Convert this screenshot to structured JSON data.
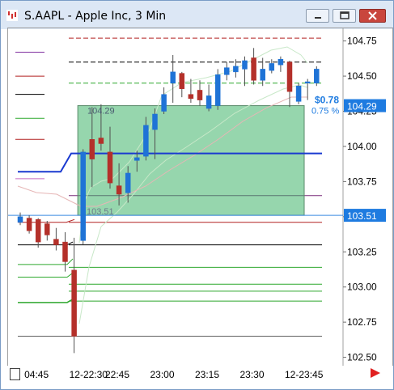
{
  "window": {
    "title": "S.AAPL - Apple Inc, 3 Min",
    "icon": "aapl-chart-icon",
    "buttons": [
      "minimize-icon",
      "maximize-icon",
      "close-icon"
    ]
  },
  "chart_data": {
    "type": "candlestick",
    "symbol": "S.AAPL",
    "interval": "3 Min",
    "ylim": [
      102.44,
      104.84
    ],
    "y_ticks": [
      "104.75",
      "104.50",
      "104.25",
      "104.00",
      "103.75",
      "103.50",
      "103.25",
      "103.00",
      "102.75",
      "102.50"
    ],
    "x_ticks": [
      "04:45",
      "12-22:30",
      "22:45",
      "23:00",
      "23:15",
      "23:30",
      "12-23:45"
    ],
    "x_tick_index": [
      1,
      6,
      10,
      15,
      20,
      25,
      30
    ],
    "candles": [
      {
        "i": 0,
        "o": 103.46,
        "h": 103.53,
        "l": 103.44,
        "c": 103.5
      },
      {
        "i": 1,
        "o": 103.49,
        "h": 103.51,
        "l": 103.38,
        "c": 103.4
      },
      {
        "i": 2,
        "o": 103.48,
        "h": 103.49,
        "l": 103.28,
        "c": 103.32
      },
      {
        "i": 3,
        "o": 103.45,
        "h": 103.47,
        "l": 103.33,
        "c": 103.37
      },
      {
        "i": 4,
        "o": 103.34,
        "h": 103.42,
        "l": 103.26,
        "c": 103.3
      },
      {
        "i": 5,
        "o": 103.32,
        "h": 103.39,
        "l": 103.11,
        "c": 103.18
      },
      {
        "i": 6,
        "o": 103.12,
        "h": 103.35,
        "l": 102.53,
        "c": 102.65
      },
      {
        "i": 7,
        "o": 103.33,
        "h": 103.98,
        "l": 103.3,
        "c": 103.96
      },
      {
        "i": 8,
        "o": 104.05,
        "h": 104.28,
        "l": 103.71,
        "c": 103.91
      },
      {
        "i": 9,
        "o": 104.06,
        "h": 104.3,
        "l": 103.97,
        "c": 104.02
      },
      {
        "i": 10,
        "o": 103.96,
        "h": 104.14,
        "l": 103.7,
        "c": 103.74
      },
      {
        "i": 11,
        "o": 103.72,
        "h": 103.88,
        "l": 103.58,
        "c": 103.66
      },
      {
        "i": 12,
        "o": 103.67,
        "h": 103.86,
        "l": 103.6,
        "c": 103.81
      },
      {
        "i": 13,
        "o": 103.9,
        "h": 103.97,
        "l": 103.82,
        "c": 103.92
      },
      {
        "i": 14,
        "o": 103.93,
        "h": 104.21,
        "l": 103.9,
        "c": 104.15
      },
      {
        "i": 15,
        "o": 104.12,
        "h": 104.27,
        "l": 103.91,
        "c": 104.23
      },
      {
        "i": 16,
        "o": 104.25,
        "h": 104.42,
        "l": 104.23,
        "c": 104.37
      },
      {
        "i": 17,
        "o": 104.45,
        "h": 104.65,
        "l": 104.31,
        "c": 104.53
      },
      {
        "i": 18,
        "o": 104.52,
        "h": 104.53,
        "l": 104.35,
        "c": 104.41
      },
      {
        "i": 19,
        "o": 104.37,
        "h": 104.48,
        "l": 104.31,
        "c": 104.34
      },
      {
        "i": 20,
        "o": 104.4,
        "h": 104.47,
        "l": 104.29,
        "c": 104.33
      },
      {
        "i": 21,
        "o": 104.27,
        "h": 104.44,
        "l": 104.25,
        "c": 104.36
      },
      {
        "i": 22,
        "o": 104.29,
        "h": 104.55,
        "l": 104.26,
        "c": 104.51
      },
      {
        "i": 23,
        "o": 104.51,
        "h": 104.6,
        "l": 104.47,
        "c": 104.56
      },
      {
        "i": 24,
        "o": 104.53,
        "h": 104.62,
        "l": 104.49,
        "c": 104.57
      },
      {
        "i": 25,
        "o": 104.55,
        "h": 104.64,
        "l": 104.43,
        "c": 104.61
      },
      {
        "i": 26,
        "o": 104.63,
        "h": 104.7,
        "l": 104.44,
        "c": 104.47
      },
      {
        "i": 27,
        "o": 104.47,
        "h": 104.63,
        "l": 104.43,
        "c": 104.55
      },
      {
        "i": 28,
        "o": 104.54,
        "h": 104.62,
        "l": 104.52,
        "c": 104.59
      },
      {
        "i": 29,
        "o": 104.58,
        "h": 104.64,
        "l": 104.53,
        "c": 104.62
      },
      {
        "i": 30,
        "o": 104.6,
        "h": 104.61,
        "l": 104.28,
        "c": 104.39
      },
      {
        "i": 31,
        "o": 104.32,
        "h": 104.45,
        "l": 104.3,
        "c": 104.43
      },
      {
        "i": 32,
        "o": 104.45,
        "h": 104.48,
        "l": 104.33,
        "c": 104.46
      },
      {
        "i": 33,
        "o": 104.45,
        "h": 104.57,
        "l": 104.43,
        "c": 104.55
      }
    ],
    "price_label": {
      "text": "104.29",
      "value": 104.29,
      "color": "#1e7be0"
    },
    "price_label_2": {
      "text": "103.51",
      "value": 103.51,
      "color": "#1e7be0"
    },
    "change_text": "$0.78",
    "change_pct_text": "0.75 %",
    "rect_high_text": "104.29",
    "rect_low_text": "103.51",
    "measure_rect": {
      "x0_index": 6.5,
      "x1_index": 34.5,
      "y_high": 104.29,
      "y_low": 103.51,
      "fill": "#3fb56a"
    },
    "colors": {
      "up": "#1f73d6",
      "down": "#b4302a",
      "wick": "#606060"
    }
  }
}
